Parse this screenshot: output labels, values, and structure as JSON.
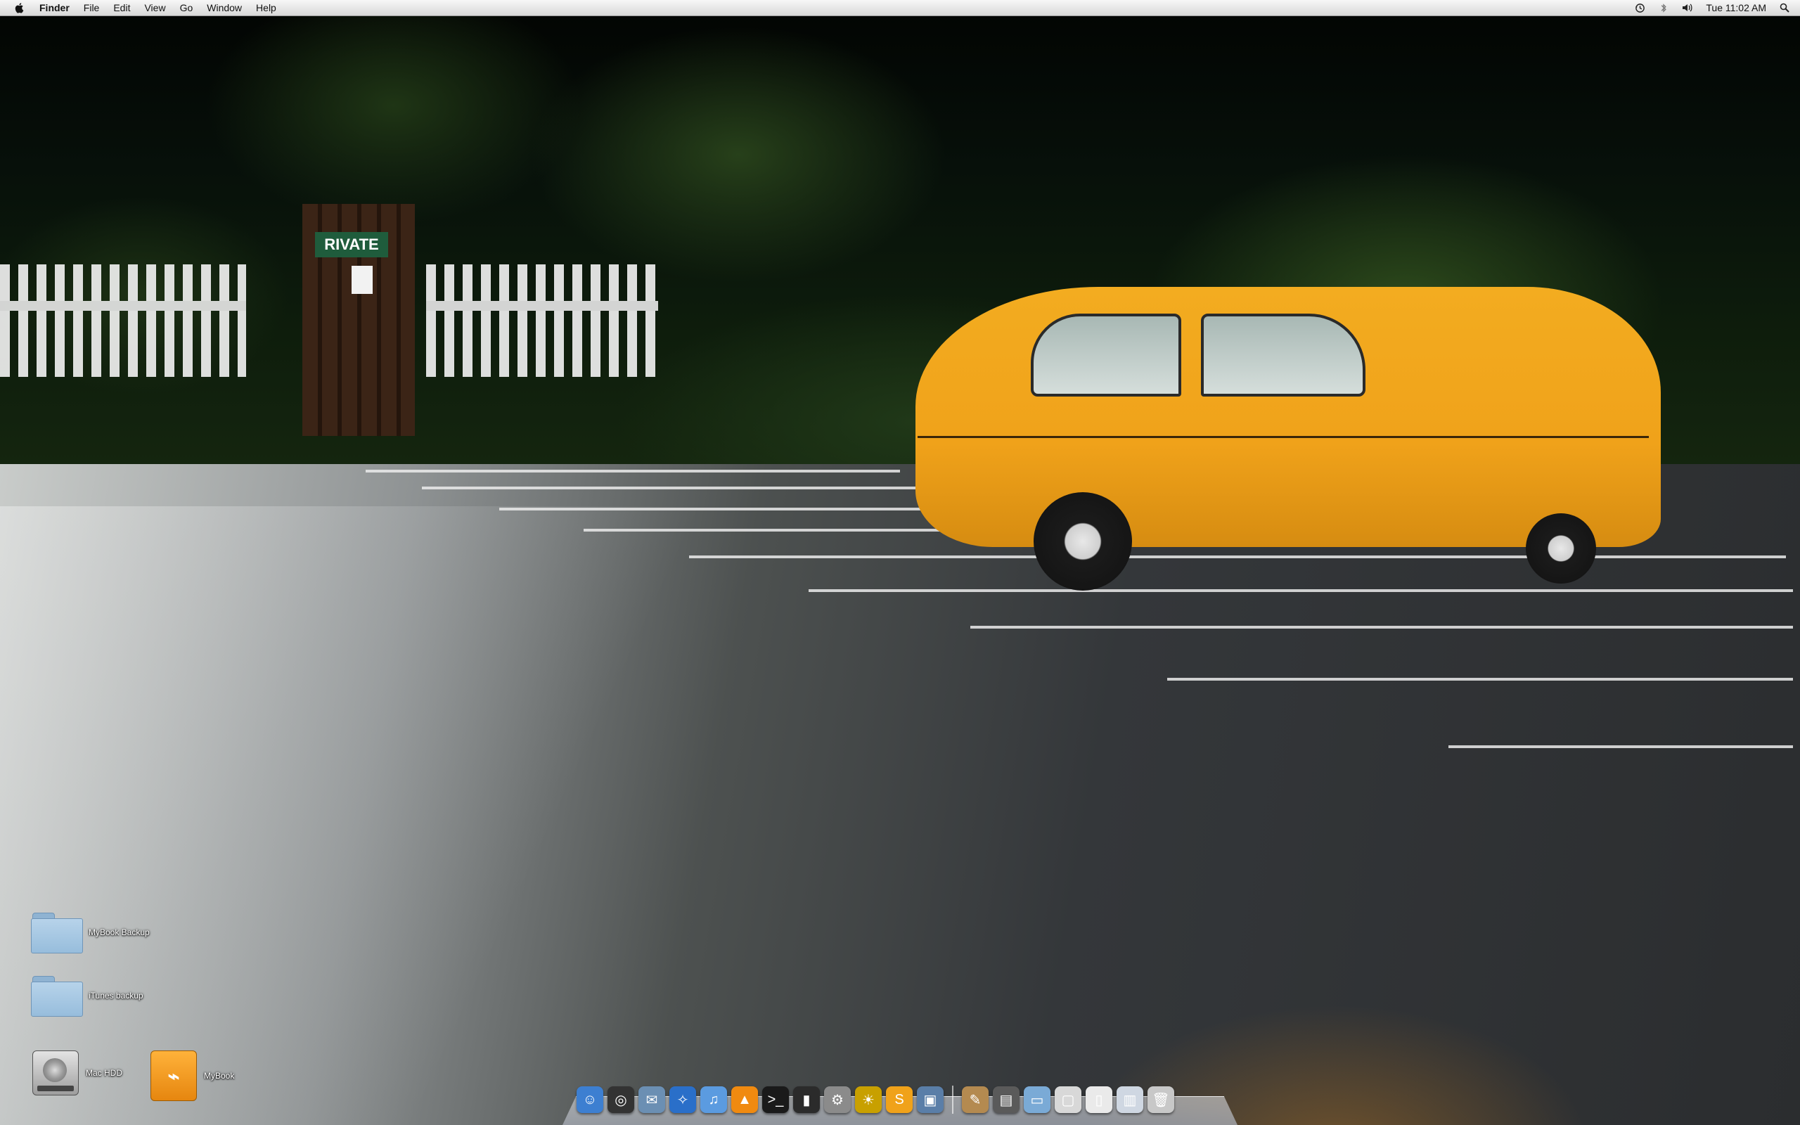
{
  "menubar": {
    "apple": "apple-icon",
    "app_name": "Finder",
    "items": [
      "File",
      "Edit",
      "View",
      "Go",
      "Window",
      "Help"
    ],
    "clock": "Tue 11:02 AM",
    "status_icons": [
      "time-machine-icon",
      "bluetooth-icon",
      "volume-icon",
      "spotlight-icon"
    ]
  },
  "desktop": {
    "icons": [
      {
        "label": "MyBook Backup",
        "icon": "folder-icon"
      },
      {
        "label": "iTunes backup",
        "icon": "folder-icon"
      },
      {
        "label": "Mac HDD",
        "icon": "hard-drive-icon"
      },
      {
        "label": "MyBook",
        "icon": "firewire-drive-icon"
      }
    ]
  },
  "wallpaper": {
    "sign_text": "RIVATE",
    "car_color": "#f0a21a"
  },
  "dock": {
    "apps": [
      {
        "name": "finder-icon",
        "color": "#3d7fd1",
        "glyph": "☺"
      },
      {
        "name": "dashboard-icon",
        "color": "#333333",
        "glyph": "◎"
      },
      {
        "name": "mail-icon",
        "color": "#6b8fb3",
        "glyph": "✉"
      },
      {
        "name": "safari-icon",
        "color": "#2a6fc9",
        "glyph": "✧"
      },
      {
        "name": "itunes-icon",
        "color": "#5b9be0",
        "glyph": "♫"
      },
      {
        "name": "vlc-icon",
        "color": "#f08a10",
        "glyph": "▲"
      },
      {
        "name": "terminal-icon",
        "color": "#1a1a1a",
        "glyph": ">_"
      },
      {
        "name": "pages-icon",
        "color": "#2b2b2b",
        "glyph": "▮"
      },
      {
        "name": "system-preferences-icon",
        "color": "#8b8b8b",
        "glyph": "⚙"
      },
      {
        "name": "sun-app-icon",
        "color": "#c8a000",
        "glyph": "☀"
      },
      {
        "name": "sketch-app-icon",
        "color": "#f0a21a",
        "glyph": "S"
      },
      {
        "name": "iphoto-icon",
        "color": "#5a7ea8",
        "glyph": "▣"
      }
    ],
    "docs": [
      {
        "name": "script-icon",
        "color": "#b48a50",
        "glyph": "✎"
      },
      {
        "name": "preview-icon",
        "color": "#5a5a5a",
        "glyph": "▤"
      },
      {
        "name": "applications-folder-icon",
        "color": "#7aaad6",
        "glyph": "▭"
      },
      {
        "name": "disk-image-icon",
        "color": "#d8d8d8",
        "glyph": "▢"
      },
      {
        "name": "document-icon",
        "color": "#eaeaea",
        "glyph": "▯"
      },
      {
        "name": "downloads-stack-icon",
        "color": "#cfd7e2",
        "glyph": "▥"
      },
      {
        "name": "trash-icon",
        "color": "#c8c8c8",
        "glyph": "🗑"
      }
    ]
  }
}
